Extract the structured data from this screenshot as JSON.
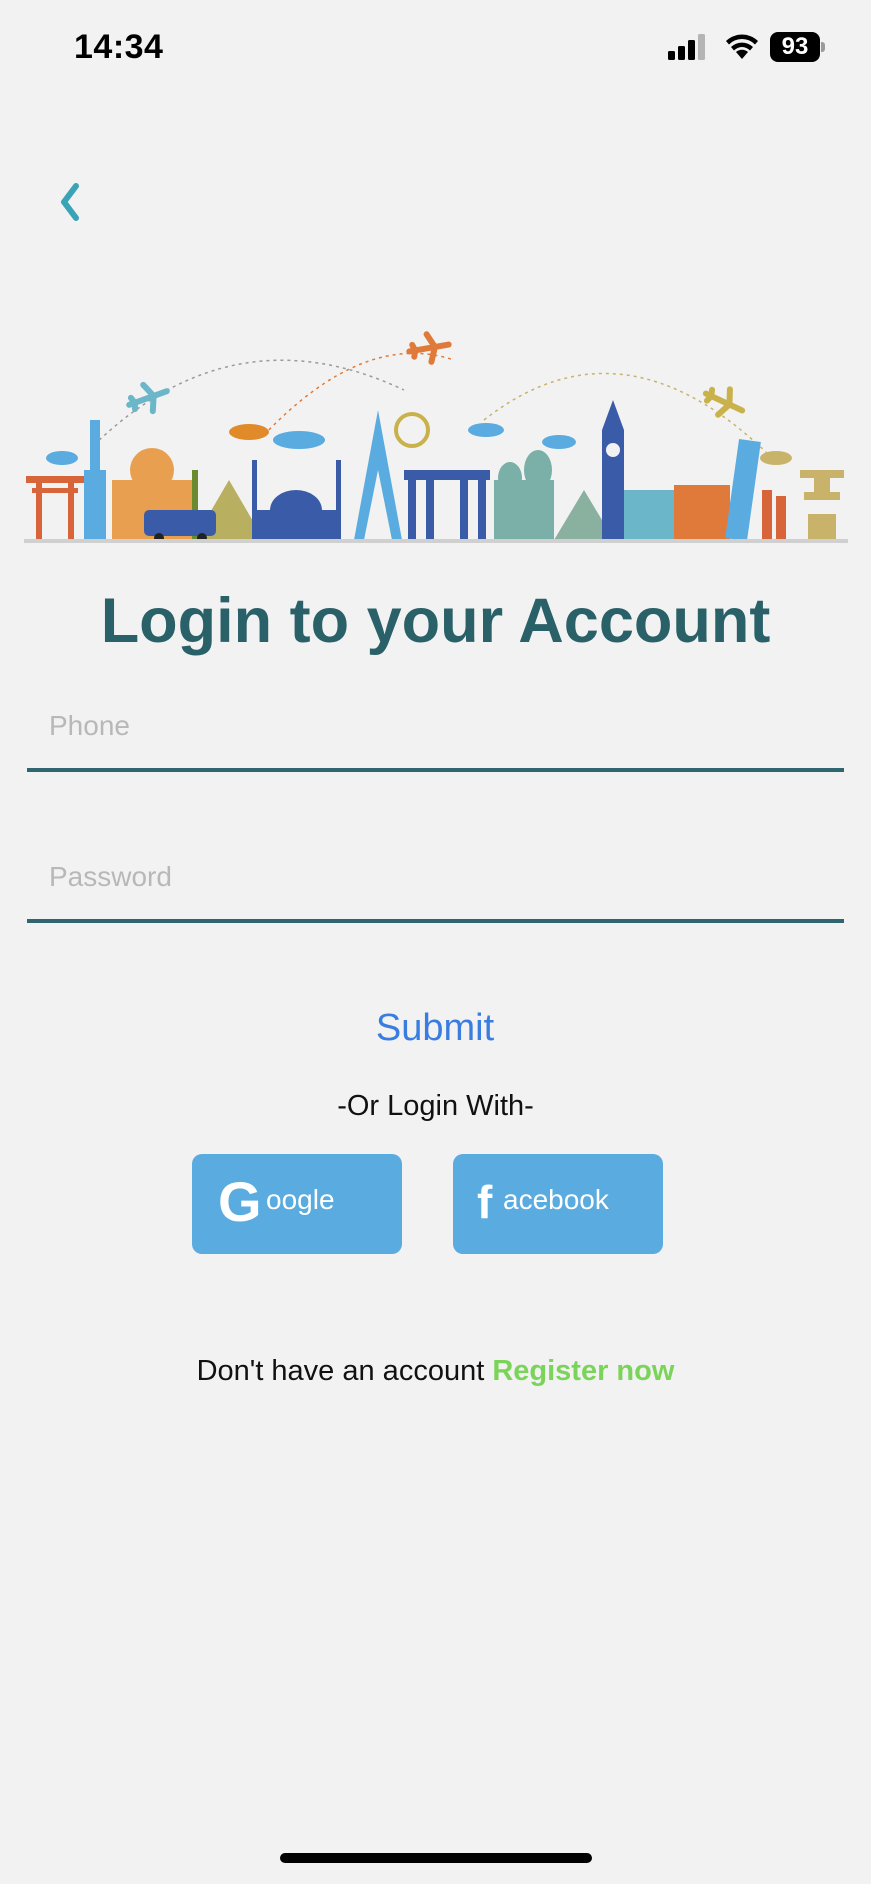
{
  "status_bar": {
    "time": "14:34",
    "battery": "93",
    "icons": [
      "signal-icon",
      "wifi-icon",
      "battery-icon"
    ]
  },
  "nav": {
    "back_icon": "chevron-left-icon",
    "accent_color": "#3aa3b5"
  },
  "banner": {
    "icon": "travel-landmarks-illustration"
  },
  "login": {
    "title": "Login to your Account",
    "phone_placeholder": "Phone",
    "phone_value": "",
    "password_placeholder": "Password",
    "password_value": "",
    "submit_label": "Submit",
    "or_label": "-Or Login With-"
  },
  "social": {
    "google_glyph": "G",
    "google_label": "oogle",
    "facebook_glyph": "f",
    "facebook_label": "acebook",
    "button_color": "#5aabdf"
  },
  "register": {
    "prompt": "Don't have an account ",
    "link_label": "Register now",
    "link_color": "#7bd45a"
  },
  "colors": {
    "title": "#2a6068",
    "field_underline": "#2f6670",
    "submit": "#3a7de0",
    "background": "#f2f2f2"
  }
}
